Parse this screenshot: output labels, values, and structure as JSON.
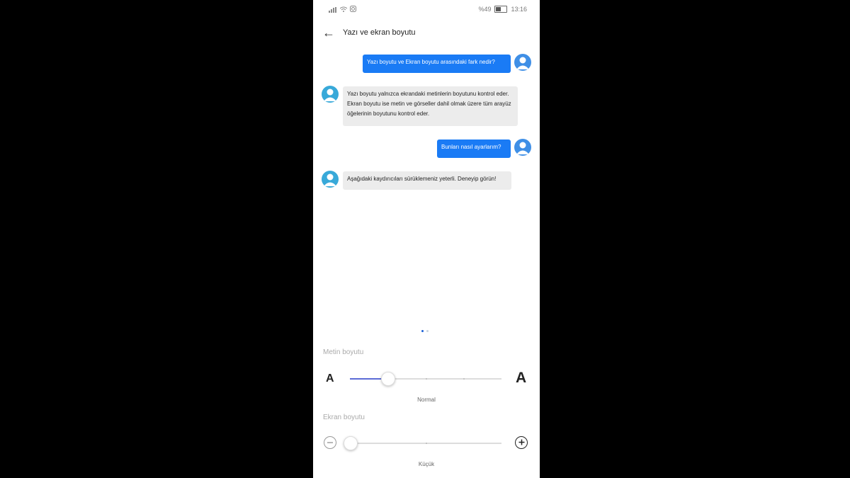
{
  "status": {
    "battery": "%49",
    "time": "13:16"
  },
  "header": {
    "title": "Yazı ve ekran boyutu"
  },
  "messages": [
    {
      "from": "user",
      "text": "Yazı boyutu ve Ekran boyutu arasındaki fark nedir?"
    },
    {
      "from": "assistant",
      "text": "Yazı boyutu yalnızca ekrandaki metinlerin boyutunu kontrol eder. Ekran boyutu ise metin ve görseller dahil olmak üzere tüm arayüz öğelerinin boyutunu kontrol eder."
    },
    {
      "from": "user",
      "text": "Bunları nasıl ayarlarım?"
    },
    {
      "from": "assistant",
      "text": "Aşağıdaki kaydırıcıları sürüklemeniz yeterli. Deneyip görün!"
    }
  ],
  "page_indicator": {
    "count": 2,
    "active": 1
  },
  "text_size": {
    "label": "Metin boyutu",
    "min_glyph": "A",
    "max_glyph": "A",
    "value_label": "Normal",
    "steps": 5,
    "position": 1
  },
  "screen_size": {
    "label": "Ekran boyutu",
    "value_label": "Küçük",
    "steps": 3,
    "position": 0,
    "minus_icon": "minus-circle-icon",
    "plus_icon": "plus-circle-icon"
  },
  "colors": {
    "accent": "#1a7bf5",
    "slider": "#5b6bd6",
    "bubble_in": "#ececec"
  }
}
